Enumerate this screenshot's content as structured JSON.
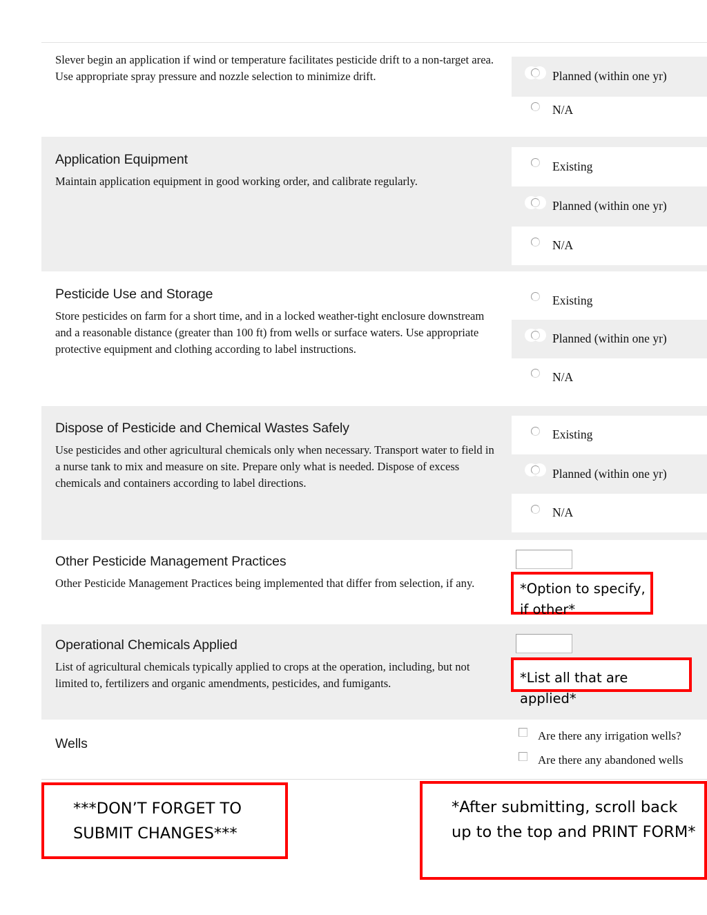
{
  "form": {
    "rows": [
      {
        "id": "pesticide-drift",
        "title": "",
        "description": "Slever begin an application if wind or temperature facilitates pesticide drift to a non-target area. Use appropriate spray pressure and nozzle selection to minimize drift.",
        "options": [
          "Planned (within one yr)",
          "N/A"
        ]
      },
      {
        "id": "application-equipment",
        "title": "Application Equipment",
        "description": "Maintain application equipment in good working order, and calibrate regularly.",
        "options": [
          "Existing",
          "Planned (within one yr)",
          "N/A"
        ]
      },
      {
        "id": "pesticide-use-and-storage",
        "title": "Pesticide Use and Storage",
        "description": "Store pesticides on farm for a short time, and in a locked weather-tight enclosure downstream and a reasonable distance (greater than 100 ft) from wells or surface waters. Use appropriate protective equipment and clothing according to label instructions.",
        "options": [
          "Existing",
          "Planned (within one yr)",
          "N/A"
        ]
      },
      {
        "id": "dispose-of-pesticide-and-chemical-wastes-safely",
        "title": "Dispose of Pesticide and Chemical Wastes Safely",
        "description": "Use pesticides and other agricultural chemicals only when necessary. Transport water to field in a nurse tank to mix and measure on site. Prepare only what is needed. Dispose of excess chemicals and containers according to label directions.",
        "options": [
          "Existing",
          "Planned (within one yr)",
          "N/A"
        ]
      },
      {
        "id": "other-pesticide-management-practices",
        "title": "Other Pesticide Management Practices",
        "description": "Other Pesticide Management Practices being implemented that differ from selection, if any.",
        "input_value": "",
        "input_placeholder": ""
      },
      {
        "id": "operational-chemicals-applied",
        "title": "Operational Chemicals Applied",
        "description": "List of agricultural chemicals typically applied to crops at the operation, including, but not limited to, fertilizers and organic amendments, pesticides, and fumigants.",
        "input_value": "",
        "input_placeholder": ""
      },
      {
        "id": "wells",
        "title": "Wells",
        "description": "",
        "checkboxes": [
          "Are there any irrigation wells?",
          "Are there any abandoned wells"
        ]
      }
    ]
  },
  "annotations": {
    "option_to_specify": "*Option to specify, if other*",
    "list_all_applied": "*List all that are applied*",
    "dont_forget": "***DON’T FORGET TO SUBMIT CHANGES***",
    "after_submitting": "*After submitting, scroll back up to the top and PRINT FORM*"
  },
  "colors": {
    "annotation_border": "#ff0000",
    "row_alt_background": "#eeeeee",
    "row_plain_background": "#ffffff",
    "text": "#111111"
  }
}
